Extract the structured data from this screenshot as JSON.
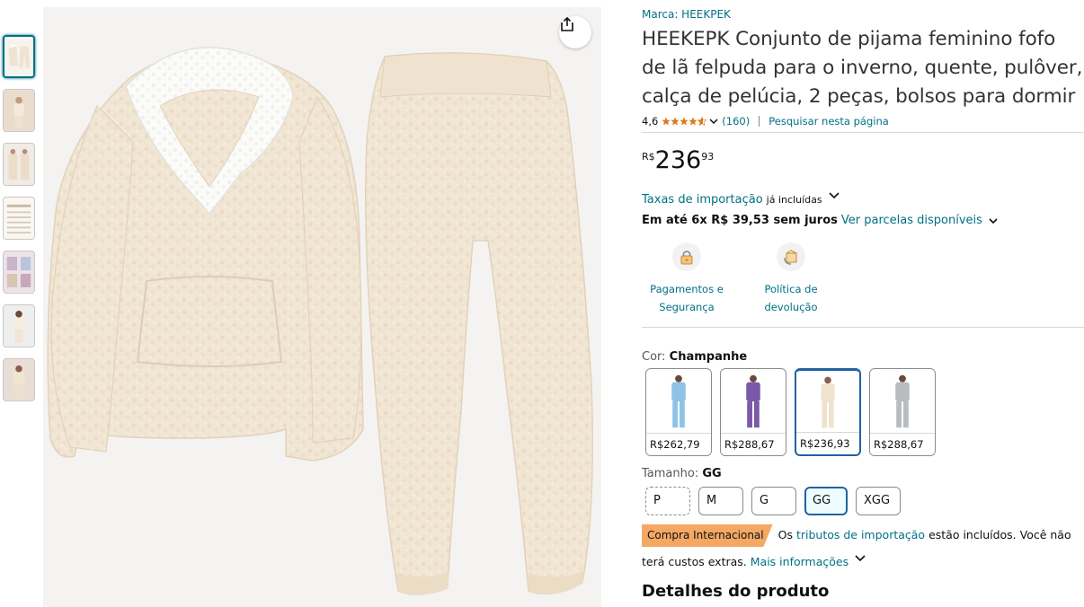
{
  "product": {
    "brand": "Marca: HEEKPEK",
    "title": "HEEKEPK Conjunto de pijama feminino fofo de lã felpuda para o inverno, quente, pulôver, calça de pelúcia, 2 peças, bolsos para dormir",
    "rating_value": "4,6",
    "rating_stars": 4.6,
    "rating_count": "(160)",
    "search_page_link": "Pesquisar nesta página"
  },
  "price": {
    "currency": "R$",
    "whole": "236",
    "fraction": "93"
  },
  "taxes": {
    "link": "Taxas de importação",
    "note": "já incluídas"
  },
  "installments": {
    "text": "Em até 6x R$ 39,53 sem juros",
    "link": "Ver parcelas disponíveis"
  },
  "features": [
    {
      "label": "Pagamentos e Segurança",
      "icon": "lock-payment-icon"
    },
    {
      "label": "Política de devolução",
      "icon": "return-box-icon"
    }
  ],
  "color": {
    "label": "Cor:",
    "selected": "Champanhe",
    "options": [
      {
        "price": "R$262,79",
        "color": "#8fc3e6"
      },
      {
        "price": "R$288,67",
        "color": "#7a5aa8"
      },
      {
        "price": "R$236,93",
        "color": "#efe3cf"
      },
      {
        "price": "R$288,67",
        "color": "#b9bcbf"
      }
    ]
  },
  "size": {
    "label": "Tamanho:",
    "selected": "GG",
    "options": [
      "P",
      "M",
      "G",
      "GG",
      "XGG"
    ]
  },
  "international": {
    "badge": "Compra Internacional",
    "text_before": "Os",
    "link": "tributos de importação",
    "text_after": "estão incluídos. Você não",
    "text_line2": "terá custos extras.",
    "more_link": "Mais informações"
  },
  "details_title": "Detalhes do produto",
  "colors": {
    "link": "#007185",
    "price_text": "#0f1111",
    "selected_border": "#2162a1",
    "badge": "#f5a863",
    "star": "#de7921"
  }
}
